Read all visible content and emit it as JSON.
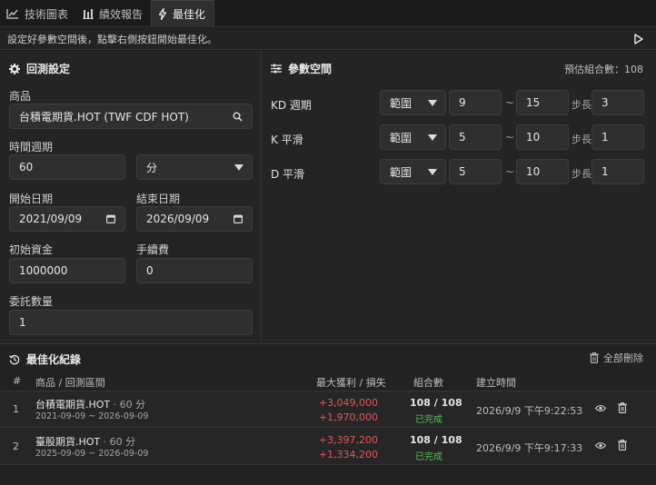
{
  "tabs": [
    {
      "label": "技術圖表",
      "icon": "line-chart-icon"
    },
    {
      "label": "績效報告",
      "icon": "bar-chart-icon"
    },
    {
      "label": "最佳化",
      "icon": "bolt-icon"
    }
  ],
  "hint": "設定好參數空間後，點擊右側按鈕開始最佳化。",
  "backtest": {
    "title": "回測設定",
    "product_label": "商品",
    "product_value": "台積電期貨.HOT (TWF CDF HOT)",
    "period_label": "時間週期",
    "period_value": "60",
    "period_unit": "分",
    "start_label": "開始日期",
    "start_value": "2021/09/09",
    "end_label": "結束日期",
    "end_value": "2026/09/09",
    "capital_label": "初始資金",
    "capital_value": "1000000",
    "fee_label": "手續費",
    "fee_value": "0",
    "qty_label": "委託數量",
    "qty_value": "1"
  },
  "params": {
    "title": "參數空間",
    "estimate": "預估組合數：108",
    "tilde": "~",
    "step_label": "步長",
    "rows": [
      {
        "name": "KD 週期",
        "mode": "範圍",
        "from": "9",
        "to": "15",
        "step": "3"
      },
      {
        "name": "K 平滑",
        "mode": "範圍",
        "from": "5",
        "to": "10",
        "step": "1"
      },
      {
        "name": "D 平滑",
        "mode": "範圍",
        "from": "5",
        "to": "10",
        "step": "1"
      }
    ]
  },
  "history": {
    "title": "最佳化紀錄",
    "delete_all": "全部刪除",
    "headers": {
      "idx": "#",
      "product": "商品 / 回測區間",
      "pnl": "最大獲利 / 損失",
      "combos": "組合數",
      "created": "建立時間"
    },
    "rows": [
      {
        "idx": "1",
        "name": "台積電期貨.HOT",
        "tf": " · 60 分",
        "range": "2021-09-09 ~ 2026-09-09",
        "max": "+3,049,000",
        "min": "+1,970,000",
        "combos": "108 / 108",
        "status": "已完成",
        "created": "2026/9/9 下午9:22:53"
      },
      {
        "idx": "2",
        "name": "臺股期貨.HOT",
        "tf": " · 60 分",
        "range": "2025-09-09 ~ 2026-09-09",
        "max": "+3,397,200",
        "min": "+1,334,200",
        "combos": "108 / 108",
        "status": "已完成",
        "created": "2026/9/9 下午9:17:33"
      }
    ]
  },
  "colors": {
    "profit": "#e25555",
    "done": "#5cbf5c",
    "bg": "#1e1e1e",
    "panel": "#242424"
  }
}
